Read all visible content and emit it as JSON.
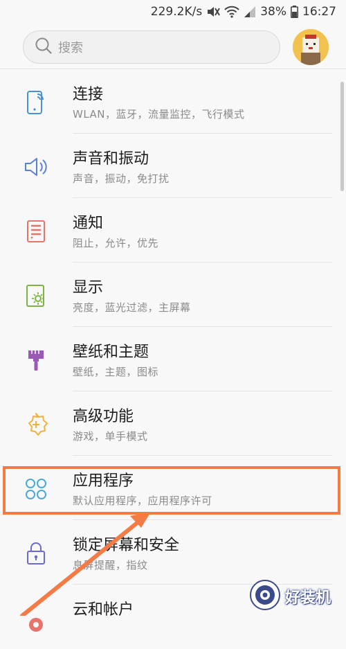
{
  "status_bar": {
    "speed": "229.2K/s",
    "battery": "38%",
    "time": "16:27"
  },
  "search": {
    "placeholder": "搜索"
  },
  "settings_items": [
    {
      "title": "连接",
      "subtitle": "WLAN，蓝牙，流量监控，飞行模式",
      "icon": "connection-icon",
      "color": "#4a90d9"
    },
    {
      "title": "声音和振动",
      "subtitle": "声音，振动，免打扰",
      "icon": "speaker-icon",
      "color": "#5a7fd6"
    },
    {
      "title": "通知",
      "subtitle": "阻止，允许，优先",
      "icon": "notification-icon",
      "color": "#e8736a"
    },
    {
      "title": "显示",
      "subtitle": "亮度，蓝光过滤，主屏幕",
      "icon": "display-icon",
      "color": "#7cb342"
    },
    {
      "title": "壁纸和主题",
      "subtitle": "壁纸，主题，图标",
      "icon": "paintbrush-icon",
      "color": "#9b59b6"
    },
    {
      "title": "高级功能",
      "subtitle": "游戏，单手模式",
      "icon": "gear-plus-icon",
      "color": "#f0b23a"
    },
    {
      "title": "应用程序",
      "subtitle": "默认应用程序，应用程序许可",
      "icon": "apps-icon",
      "color": "#4aa8d9"
    },
    {
      "title": "锁定屏幕和安全",
      "subtitle": "息屏提醒，指纹",
      "icon": "lock-icon",
      "color": "#6a6ad0"
    },
    {
      "title": "云和帐户",
      "subtitle": "",
      "icon": "cloud-icon",
      "color": "#e8736a"
    }
  ],
  "annotation": {
    "highlight_color": "#f47a46"
  },
  "watermark": {
    "text": "好装机"
  }
}
